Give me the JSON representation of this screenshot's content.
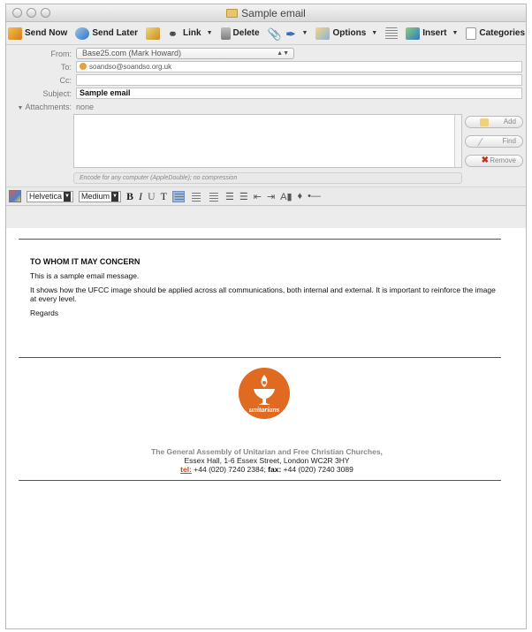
{
  "window": {
    "title": "Sample email"
  },
  "toolbar": {
    "send_now": "Send Now",
    "send_later": "Send Later",
    "link": "Link",
    "delete": "Delete",
    "options": "Options",
    "insert": "Insert",
    "categories": "Categories"
  },
  "headers": {
    "from_label": "From:",
    "from_value": "Base25.com (Mark Howard)",
    "to_label": "To:",
    "to_value": "soandso@soandso.org.uk",
    "cc_label": "Cc:",
    "subject_label": "Subject:",
    "subject_value": "Sample email",
    "attachments_label": "Attachments:",
    "attachments_value": "none",
    "encode_text": "Encode for any computer (AppleDouble); no compression"
  },
  "attach_buttons": {
    "add": "Add",
    "find": "Find",
    "remove": "Remove"
  },
  "format": {
    "font": "Helvetica",
    "size": "Medium",
    "bold": "B",
    "italic": "I",
    "underline": "U",
    "text": "T"
  },
  "message": {
    "heading": "TO WHOM IT MAY CONCERN",
    "line1": "This is a sample email message.",
    "line2": "It shows how the UFCC image should be applied across all communications, both internal and external. It is important to reinforce the image at every level.",
    "signoff": "Regards"
  },
  "logo": {
    "label": "unitarians"
  },
  "footer": {
    "org": "The General Assembly of Unitarian and Free Christian Churches,",
    "address": "Essex Hall, 1-6 Essex Street, London WC2R 3HY",
    "tel_label": "tel:",
    "tel_value": " +44 (020) 7240 2384; ",
    "fax_label": "fax:",
    "fax_value": " +44 (020) 7240 3089"
  },
  "colors": {
    "accent_orange": "#e06a1f",
    "selected_align": "#9cb7dc"
  }
}
